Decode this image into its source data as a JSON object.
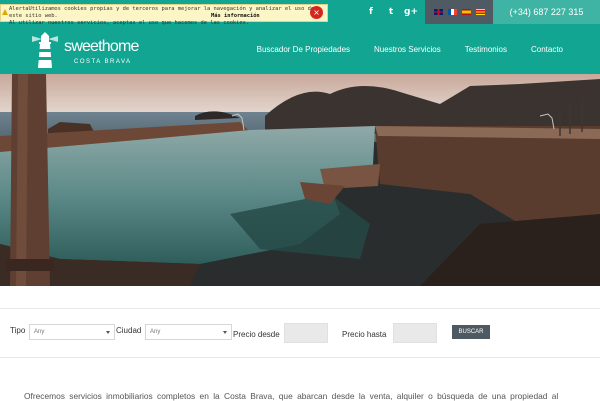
{
  "cookie_banner": {
    "line1": "AlertaUtilizamos cookies propias y de terceros para mejorar la navegación y analizar el uso de este sitio web.",
    "line2": "Al utilizar nuestros servicios, aceptas el uso que hacemos de las cookies.",
    "more_info": "Más información",
    "close": "×"
  },
  "topbar": {
    "social_icons": [
      "facebook-icon",
      "twitter-icon",
      "google-plus-icon"
    ],
    "social_glyphs": [
      "f",
      "t",
      "g+"
    ],
    "languages": [
      "en-flag-icon",
      "fr-flag-icon",
      "es-flag-icon",
      "ca-flag-icon"
    ],
    "phone": "(+34) 687 227 315"
  },
  "brand": {
    "name": "sweethome",
    "sub": "COSTA BRAVA"
  },
  "nav": {
    "items": [
      "Buscador De Propiedades",
      "Nuestros Servicios",
      "Testimonios",
      "Contacto"
    ]
  },
  "search": {
    "tipo_label": "Tipo",
    "tipo_value": "Any",
    "ciudad_label": "Ciudad",
    "ciudad_value": "Any",
    "precio_desde_label": "Precio desde",
    "precio_hasta_label": "Precio hasta",
    "button": "BUSCAR"
  },
  "intro_text": "Ofrecemos servicios inmobiliarios completos en la Costa Brava, que abarcan desde la venta, alquiler o búsqueda de una propiedad al",
  "colors": {
    "brand": "#12a591",
    "dark": "#4f5a62",
    "phone_bg": "#3fb4a5"
  }
}
